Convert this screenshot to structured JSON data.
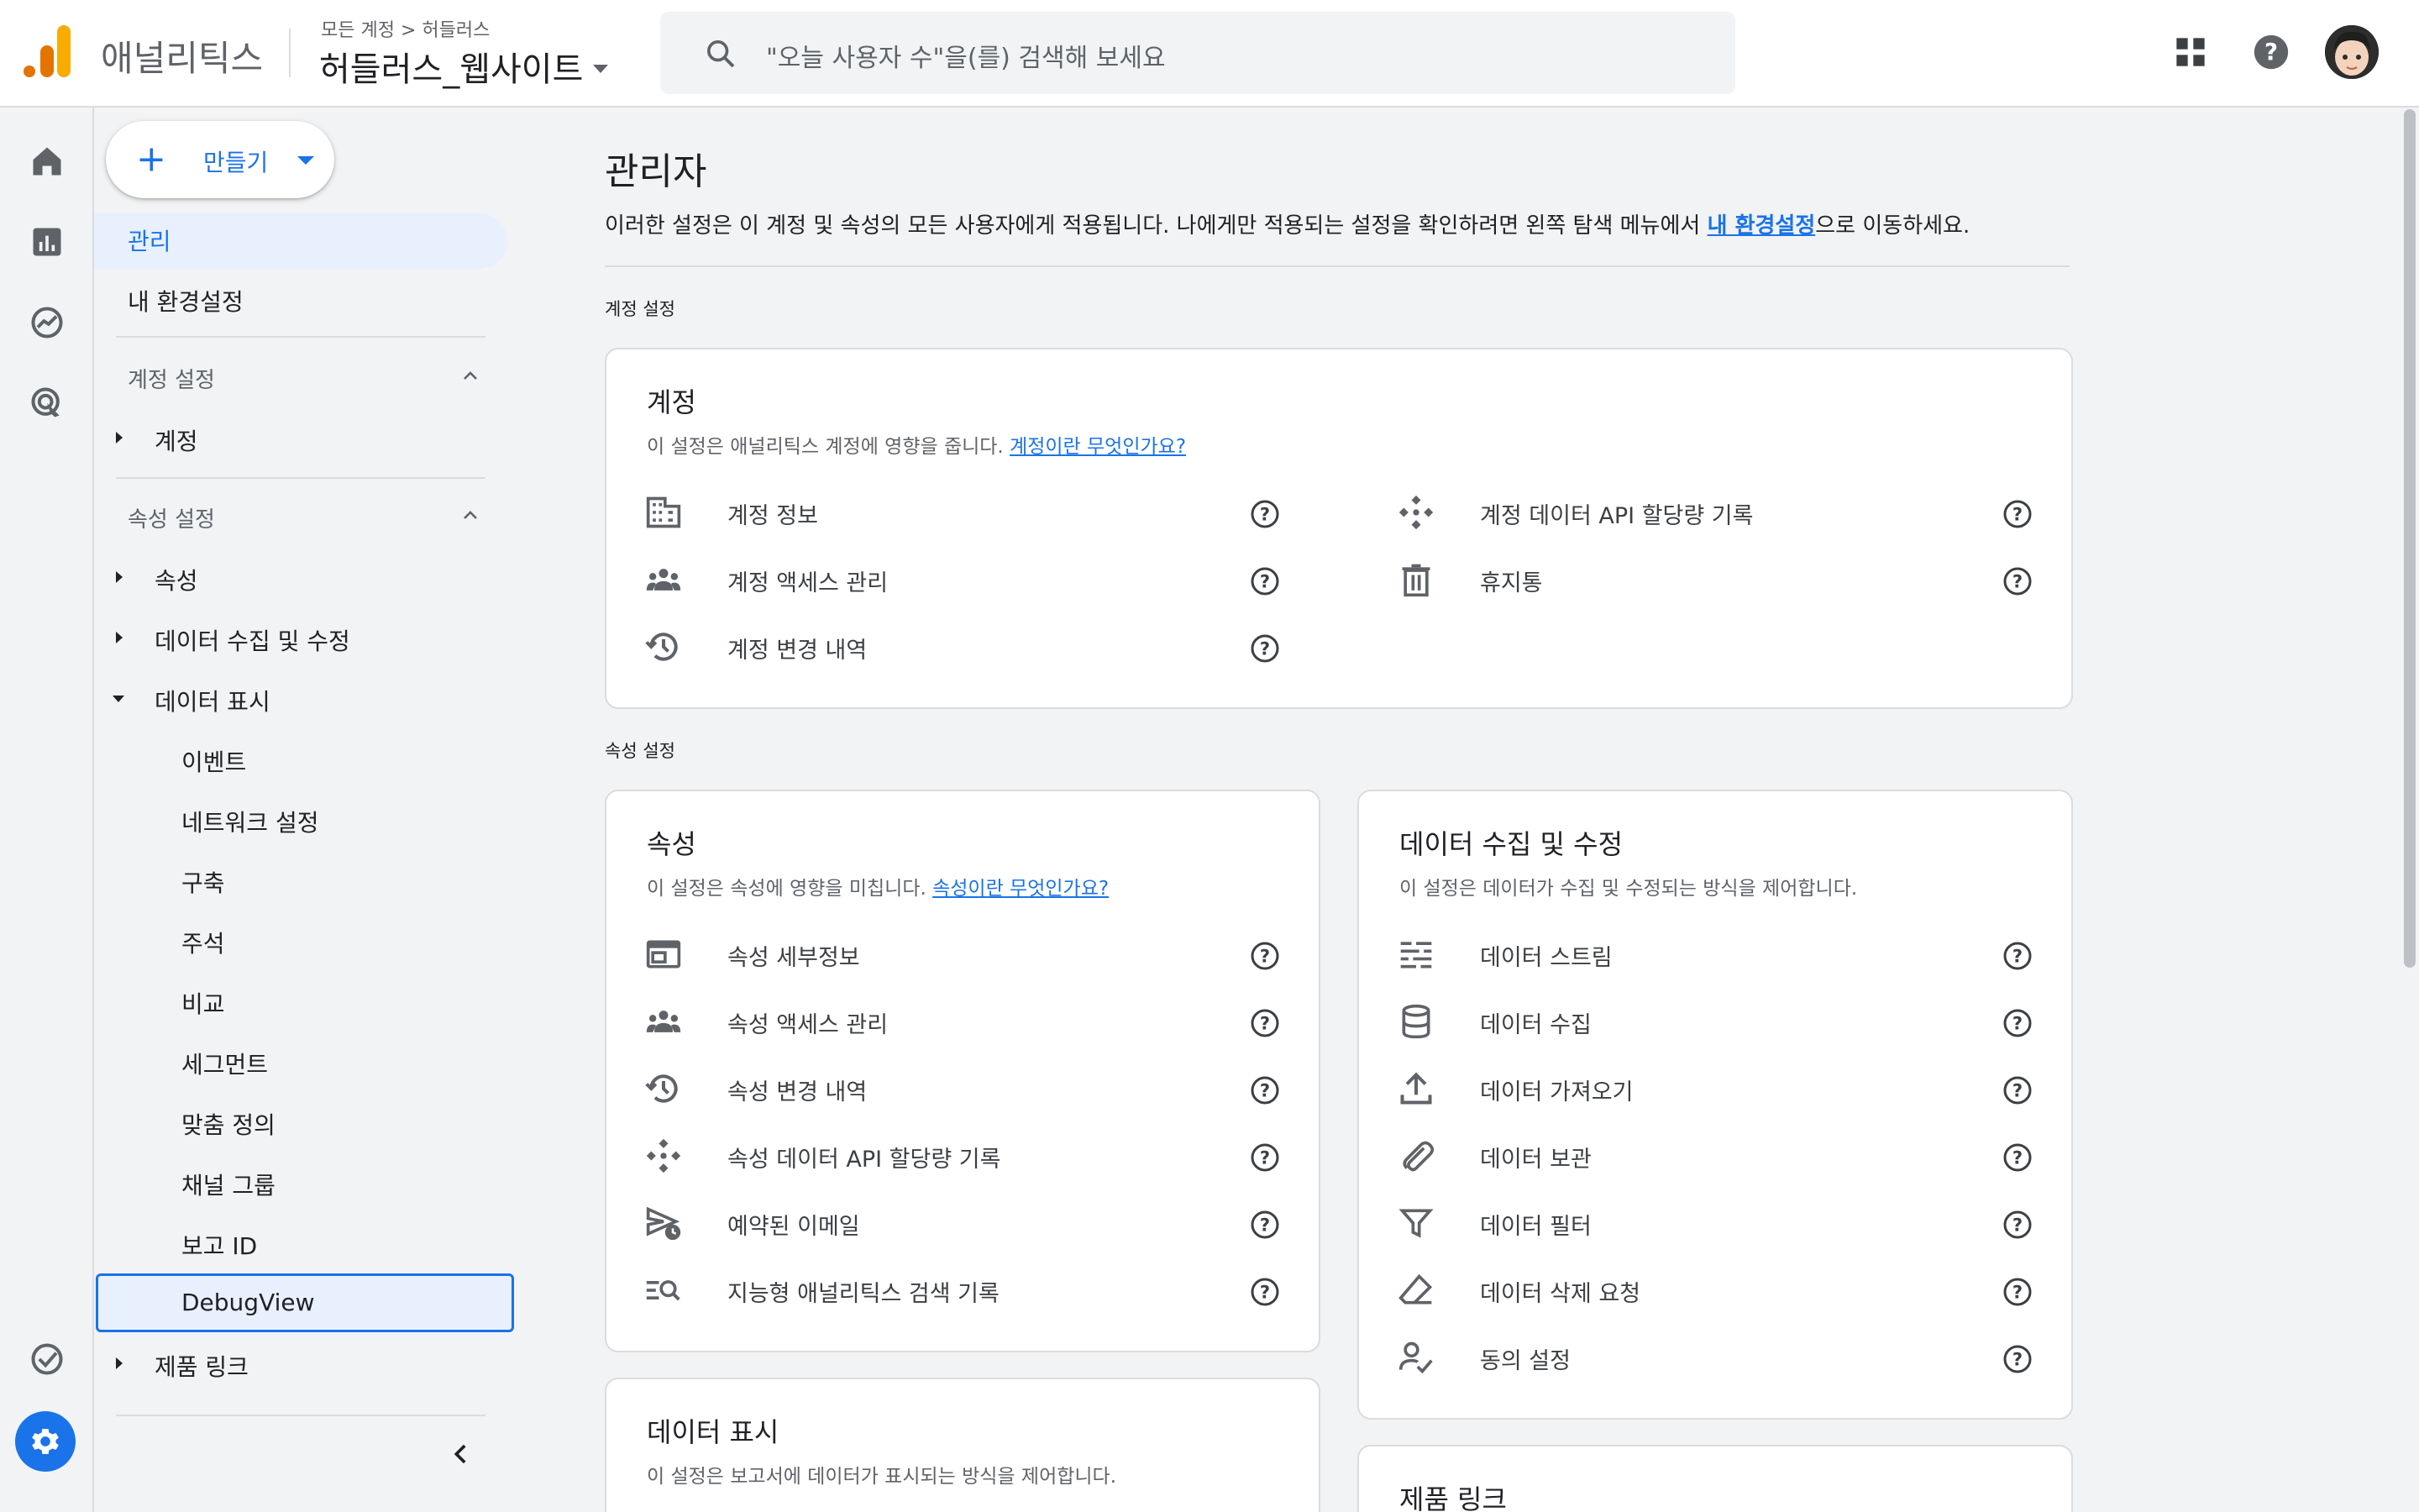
{
  "header": {
    "brand": "애널리틱스",
    "breadcrumb": "모든 계정 > 허들러스",
    "property_name": "허들러스_웹사이트",
    "search_placeholder": "\"오늘 사용자 수\"을(를) 검색해 보세요",
    "icons": [
      "analytics-logo-icon",
      "search-icon",
      "apps-grid-icon",
      "help-icon",
      "user-avatar"
    ]
  },
  "rail": {
    "items": [
      "home-icon",
      "reports-icon",
      "explore-icon",
      "advertising-icon",
      "check-circle-icon",
      "settings-gear-icon"
    ],
    "accent": "#1a73e8"
  },
  "sidenav": {
    "create_label": "만들기",
    "admin": "관리",
    "my_settings": "내 환경설정",
    "account_settings_label": "계정 설정",
    "account": "계정",
    "property_settings_label": "속성 설정",
    "property": "속성",
    "data_collection": "데이터 수집 및 수정",
    "data_display": "데이터 표시",
    "sub_items": [
      "이벤트",
      "네트워크 설정",
      "구축",
      "주석",
      "비교",
      "세그먼트",
      "맞춤 정의",
      "채널 그룹",
      "보고 ID",
      "DebugView"
    ],
    "product_links": "제품 링크"
  },
  "main": {
    "title": "관리자",
    "desc_prefix": "이러한 설정은 이 계정 및 속성의 모든 사용자에게 적용됩니다. 나에게만 적용되는 설정을 확인하려면 왼쪽 탐색 메뉴에서 ",
    "desc_link": "내 환경설정",
    "desc_suffix": "으로 이동하세요.",
    "account_group": "계정 설정",
    "property_group": "속성 설정",
    "account_card": {
      "title": "계정",
      "desc": "이 설정은 애널리틱스 계정에 영향을 줍니다. ",
      "link": "계정이란 무엇인가요?",
      "left": [
        "계정 정보",
        "계정 액세스 관리",
        "계정 변경 내역"
      ],
      "right": [
        "계정 데이터 API 할당량 기록",
        "휴지통"
      ]
    },
    "property_card": {
      "title": "속성",
      "desc": "이 설정은 속성에 영향을 미칩니다. ",
      "link": "속성이란 무엇인가요?",
      "rows": [
        "속성 세부정보",
        "속성 액세스 관리",
        "속성 변경 내역",
        "속성 데이터 API 할당량 기록",
        "예약된 이메일",
        "지능형 애널리틱스 검색 기록"
      ]
    },
    "data_collection_card": {
      "title": "데이터 수집 및 수정",
      "desc": "이 설정은 데이터가 수집 및 수정되는 방식을 제어합니다.",
      "rows": [
        "데이터 스트림",
        "데이터 수집",
        "데이터 가져오기",
        "데이터 보관",
        "데이터 필터",
        "데이터 삭제 요청",
        "동의 설정"
      ]
    },
    "data_display_card": {
      "title": "데이터 표시",
      "desc": "이 설정은 보고서에 데이터가 표시되는 방식을 제어합니다."
    },
    "product_links_card": {
      "title": "제품 링크"
    }
  }
}
